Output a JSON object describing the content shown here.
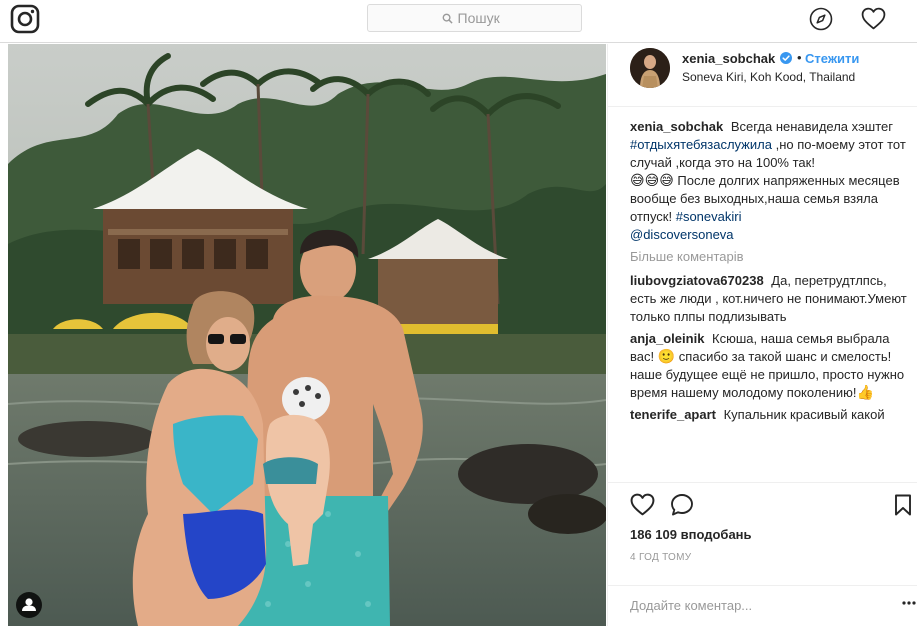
{
  "search": {
    "placeholder": "Пошук"
  },
  "post": {
    "username": "xenia_sobchak",
    "follow_label": "Стежити",
    "location": "Soneva Kiri, Koh Kood, Thailand",
    "caption": {
      "username": "xenia_sobchak",
      "text_1": "Всегда ненавидела хэштег",
      "hashtag_1": "#отдыхятебязаслужила",
      "text_2": ",но по-моему этот тот случай ,когда это на 100% так!",
      "emoji_1": "😅😅😅",
      "text_3": "После долгих напряженных месяцев вообще без выходных,наша семья взяла отпуск!",
      "hashtag_2": "#sonevakiri",
      "mention_1": "@discoversoneva"
    },
    "more_comments_label": "Більше коментарів",
    "comments": [
      {
        "username": "liubovgziatova670238",
        "text": "Да, перетрудтлпсь, есть же люди , кот.ничего не понимают.Умеют только плпы подлизывать"
      },
      {
        "username": "anja_oleinik",
        "text_a": "Ксюша, наша семья выбрала вас!",
        "emoji": "🙂",
        "text_b": "спасибо за такой шанс и смелость! наше будущее ещё не пришло, просто нужно время нашему молодому поколению!",
        "emoji_end": "👍"
      },
      {
        "username": "tenerife_apart",
        "text": "Купальник красивый какой"
      }
    ],
    "likes": "186 109 вподобань",
    "time_ago": "4 ГОД ТОМУ",
    "add_comment_placeholder": "Додайте коментар..."
  },
  "icons": {
    "logo": "instagram-logo-icon",
    "search": "search-icon",
    "explore": "compass-icon",
    "activity": "heart-icon",
    "verified": "verified-badge-icon",
    "like": "heart-icon",
    "comment": "comment-bubble-icon",
    "save": "bookmark-icon",
    "more": "ellipsis-icon",
    "tags": "person-tag-icon"
  },
  "colors": {
    "link_blue": "#3897f0",
    "hashtag": "#003569",
    "border": "#dbdbdb",
    "muted": "#999999"
  }
}
